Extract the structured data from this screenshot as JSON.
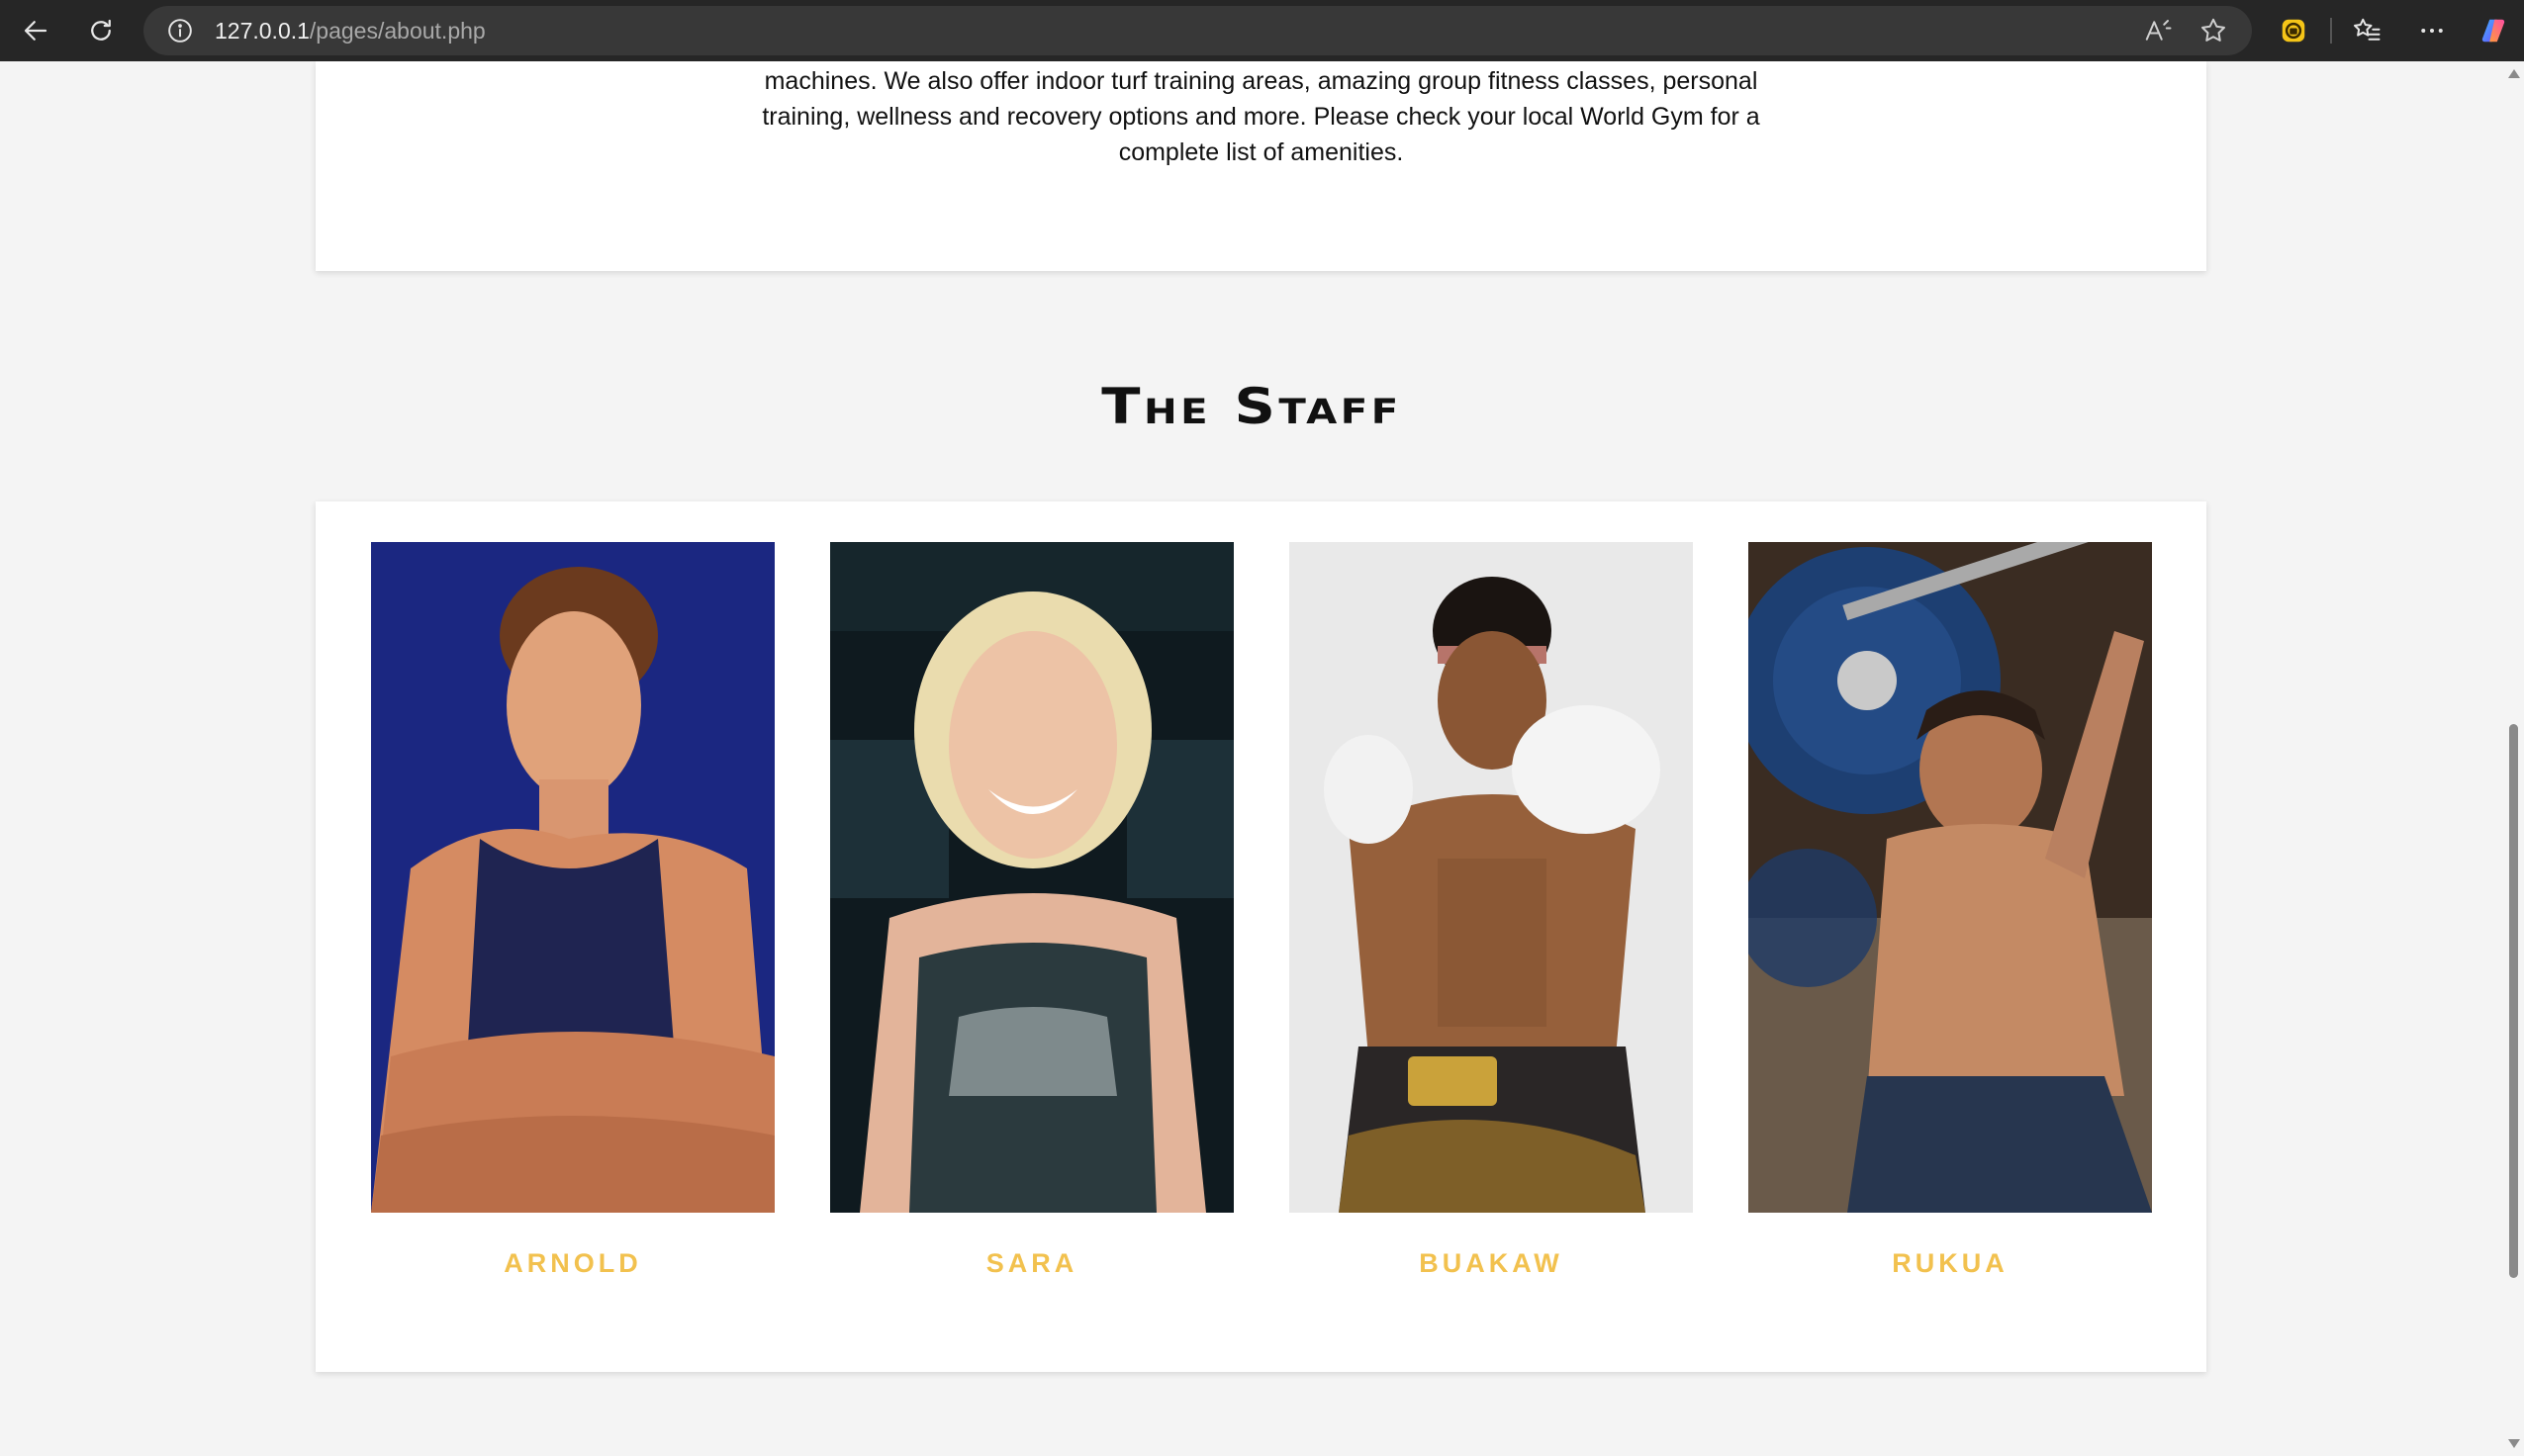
{
  "browser": {
    "url_host": "127.0.0.1",
    "url_path": "/pages/about.php",
    "icons": [
      "back-arrow-icon",
      "refresh-icon",
      "info-icon",
      "read-aloud-icon",
      "favorite-star-icon",
      "extension-icon",
      "favorites-icon",
      "more-icon",
      "copilot-icon"
    ]
  },
  "about": {
    "line1": "machines. We also offer indoor turf training areas, amazing group fitness classes, personal",
    "line2": "training, wellness and recovery options and more. Please check your local World Gym for a",
    "line3": "complete list of amenities."
  },
  "staff": {
    "title": "The Staff",
    "name_color": "#f2c14e",
    "members": [
      {
        "name": "ARNOLD"
      },
      {
        "name": "SARA"
      },
      {
        "name": "BUAKAW"
      },
      {
        "name": "RUKUA"
      }
    ]
  }
}
